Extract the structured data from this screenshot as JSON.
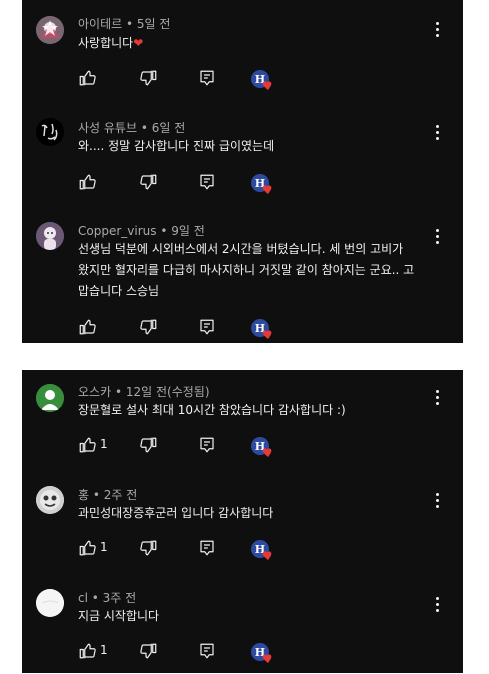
{
  "comments": [
    {
      "author": "아이테르",
      "time": "5일 전",
      "body": "사랑합니다",
      "heart_emoji": "❤",
      "likes": "",
      "avatar": "avatar-star-figure"
    },
    {
      "author": "사성 유튜브",
      "time": "6일 전",
      "body": "와.... 정말 감사합니다 진짜 급이였는데",
      "likes": "",
      "avatar": "avatar-calligraphy"
    },
    {
      "author": "Copper_virus",
      "time": "9일 전",
      "body_lines": [
        "선생님 덕분에 시외버스에서 2시간을 버텼습니다. 세 번의 고비가",
        "왔지만 혈자리를 다급히 마사지하니 거짓말 같이 참아지는 군요.. 고",
        "맙습니다 스승님"
      ],
      "likes": "",
      "avatar": "avatar-character"
    },
    {
      "author": "오스카",
      "time": "12일 전(수정됨)",
      "body": "장문혈로 설사 최대 10시간 참았습니다 감사합니다 :)",
      "likes": "1",
      "avatar": "avatar-green-person"
    },
    {
      "author": "홍",
      "time": "2주 전",
      "body": "과민성대장증후군러 입니다 감사합니다",
      "likes": "1",
      "avatar": "avatar-cartoon"
    },
    {
      "author": "cl",
      "time": "3주 전",
      "body": "지금 시작합니다",
      "likes": "1",
      "avatar": "avatar-white-circle"
    }
  ],
  "meta_separator": "•",
  "creator_badge": {
    "letter": "H",
    "icon": "creator-heart-icon"
  },
  "icons": {
    "like": "thumbs-up-icon",
    "dislike": "thumbs-down-icon",
    "reply": "reply-icon",
    "more": "more-vertical-icon"
  },
  "colors": {
    "background": "#0f0f0f",
    "text": "#f1f1f1",
    "meta": "#aaaaaa",
    "heart": "#e53935",
    "badge_blue": "#2e4a9e"
  }
}
